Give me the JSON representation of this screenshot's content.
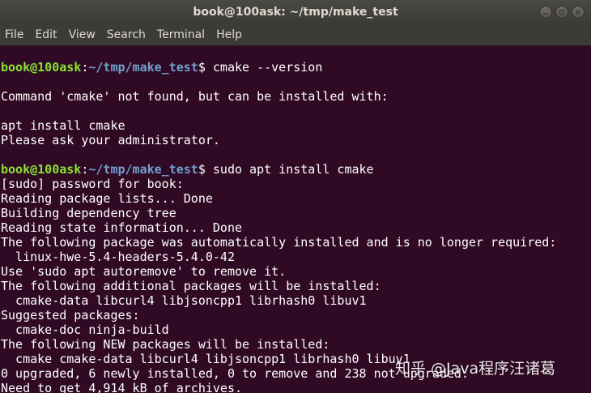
{
  "window": {
    "title": "book@100ask: ~/tmp/make_test"
  },
  "menu": [
    "File",
    "Edit",
    "View",
    "Search",
    "Terminal",
    "Help"
  ],
  "colors": {
    "background": "#300a24",
    "prompt_user": "#8ae234",
    "prompt_path": "#729fcf",
    "text": "#ffffff"
  },
  "terminal": {
    "lines": [
      {
        "type": "prompt",
        "user": "book@100ask",
        "sep": ":",
        "path": "~/tmp/make_test",
        "end": "$ ",
        "cmd": "cmake --version"
      },
      {
        "type": "text",
        "text": ""
      },
      {
        "type": "text",
        "text": "Command 'cmake' not found, but can be installed with:"
      },
      {
        "type": "text",
        "text": ""
      },
      {
        "type": "text",
        "text": "apt install cmake"
      },
      {
        "type": "text",
        "text": "Please ask your administrator."
      },
      {
        "type": "text",
        "text": ""
      },
      {
        "type": "prompt",
        "user": "book@100ask",
        "sep": ":",
        "path": "~/tmp/make_test",
        "end": "$ ",
        "cmd": "sudo apt install cmake"
      },
      {
        "type": "text",
        "text": "[sudo] password for book:"
      },
      {
        "type": "text",
        "text": "Reading package lists... Done"
      },
      {
        "type": "text",
        "text": "Building dependency tree"
      },
      {
        "type": "text",
        "text": "Reading state information... Done"
      },
      {
        "type": "text",
        "text": "The following package was automatically installed and is no longer required:"
      },
      {
        "type": "text",
        "text": "  linux-hwe-5.4-headers-5.4.0-42"
      },
      {
        "type": "text",
        "text": "Use 'sudo apt autoremove' to remove it."
      },
      {
        "type": "text",
        "text": "The following additional packages will be installed:"
      },
      {
        "type": "text",
        "text": "  cmake-data libcurl4 libjsoncpp1 librhash0 libuv1"
      },
      {
        "type": "text",
        "text": "Suggested packages:"
      },
      {
        "type": "text",
        "text": "  cmake-doc ninja-build"
      },
      {
        "type": "text",
        "text": "The following NEW packages will be installed:"
      },
      {
        "type": "text",
        "text": "  cmake cmake-data libcurl4 libjsoncpp1 librhash0 libuv1"
      },
      {
        "type": "text",
        "text": "0 upgraded, 6 newly installed, 0 to remove and 238 not upgraded."
      },
      {
        "type": "text",
        "text": "Need to get 4,914 kB of archives."
      }
    ]
  },
  "watermark": "知乎 @Java程序汪诸葛"
}
